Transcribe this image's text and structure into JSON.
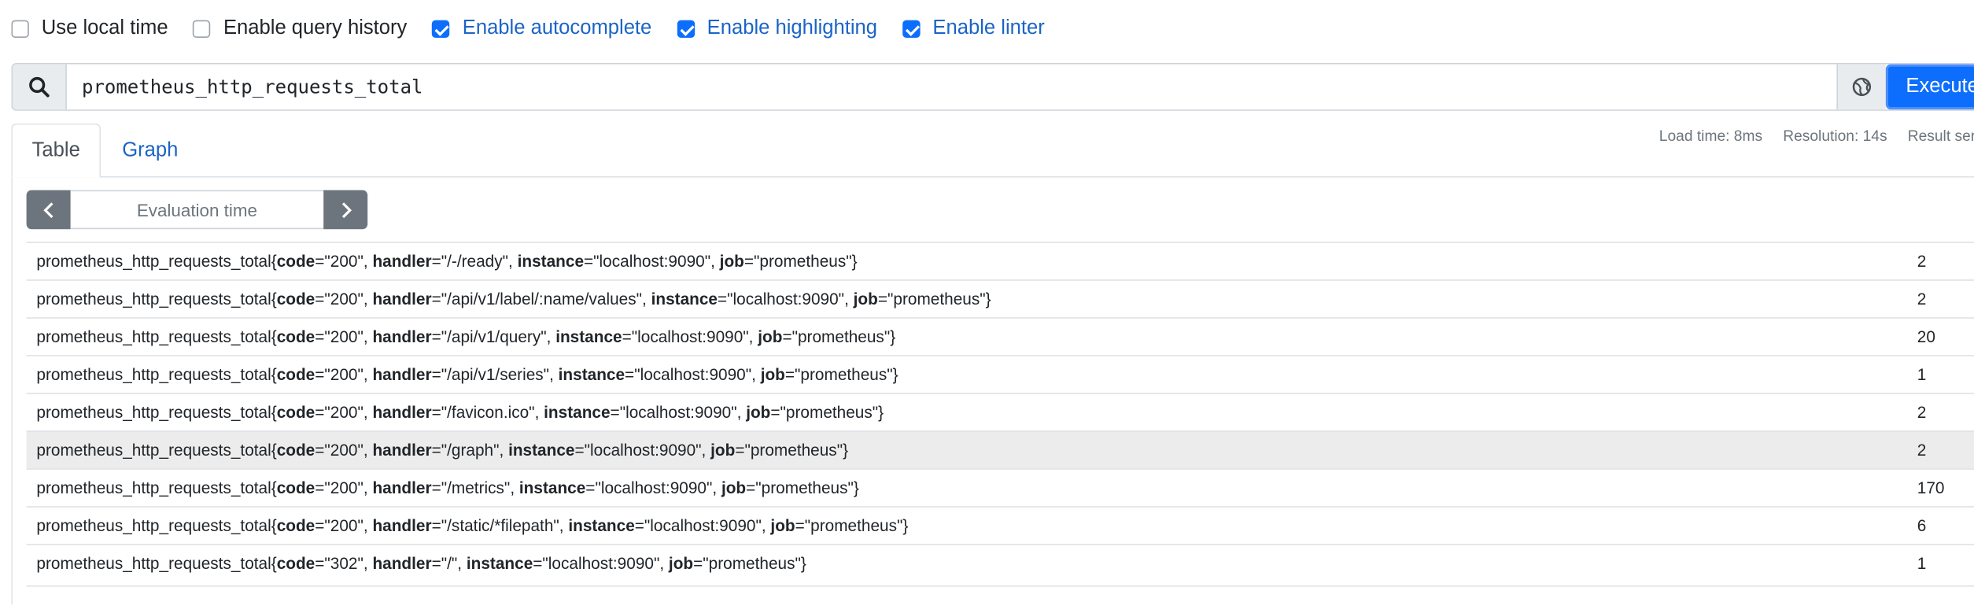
{
  "options": [
    {
      "label": "Use local time",
      "checked": false
    },
    {
      "label": "Enable query history",
      "checked": false
    },
    {
      "label": "Enable autocomplete",
      "checked": true
    },
    {
      "label": "Enable highlighting",
      "checked": true
    },
    {
      "label": "Enable linter",
      "checked": true
    }
  ],
  "query": {
    "value": "prometheus_http_requests_total",
    "execute_label": "Execute"
  },
  "stats": {
    "load_time": "Load time: 8ms",
    "resolution": "Resolution: 14s",
    "result_series": "Result series"
  },
  "tabs": {
    "table": "Table",
    "graph": "Graph"
  },
  "eval": {
    "placeholder": "Evaluation time"
  },
  "colors": {
    "accent": "#0d6efd",
    "link": "#1a64c8",
    "nav_button": "#6c757d",
    "highlight_row": "#ececec"
  },
  "results": {
    "metric": "prometheus_http_requests_total",
    "rows": [
      {
        "labels": [
          {
            "k": "code",
            "v": "\"200\""
          },
          {
            "k": "handler",
            "v": "\"/-/ready\""
          },
          {
            "k": "instance",
            "v": "\"localhost:9090\""
          },
          {
            "k": "job",
            "v": "\"prometheus\""
          }
        ],
        "value": "2"
      },
      {
        "labels": [
          {
            "k": "code",
            "v": "\"200\""
          },
          {
            "k": "handler",
            "v": "\"/api/v1/label/:name/values\""
          },
          {
            "k": "instance",
            "v": "\"localhost:9090\""
          },
          {
            "k": "job",
            "v": "\"prometheus\""
          }
        ],
        "value": "2"
      },
      {
        "labels": [
          {
            "k": "code",
            "v": "\"200\""
          },
          {
            "k": "handler",
            "v": "\"/api/v1/query\""
          },
          {
            "k": "instance",
            "v": "\"localhost:9090\""
          },
          {
            "k": "job",
            "v": "\"prometheus\""
          }
        ],
        "value": "20"
      },
      {
        "labels": [
          {
            "k": "code",
            "v": "\"200\""
          },
          {
            "k": "handler",
            "v": "\"/api/v1/series\""
          },
          {
            "k": "instance",
            "v": "\"localhost:9090\""
          },
          {
            "k": "job",
            "v": "\"prometheus\""
          }
        ],
        "value": "1"
      },
      {
        "labels": [
          {
            "k": "code",
            "v": "\"200\""
          },
          {
            "k": "handler",
            "v": "\"/favicon.ico\""
          },
          {
            "k": "instance",
            "v": "\"localhost:9090\""
          },
          {
            "k": "job",
            "v": "\"prometheus\""
          }
        ],
        "value": "2"
      },
      {
        "labels": [
          {
            "k": "code",
            "v": "\"200\""
          },
          {
            "k": "handler",
            "v": "\"/graph\""
          },
          {
            "k": "instance",
            "v": "\"localhost:9090\""
          },
          {
            "k": "job",
            "v": "\"prometheus\""
          }
        ],
        "value": "2",
        "highlighted": true
      },
      {
        "labels": [
          {
            "k": "code",
            "v": "\"200\""
          },
          {
            "k": "handler",
            "v": "\"/metrics\""
          },
          {
            "k": "instance",
            "v": "\"localhost:9090\""
          },
          {
            "k": "job",
            "v": "\"prometheus\""
          }
        ],
        "value": "170"
      },
      {
        "labels": [
          {
            "k": "code",
            "v": "\"200\""
          },
          {
            "k": "handler",
            "v": "\"/static/*filepath\""
          },
          {
            "k": "instance",
            "v": "\"localhost:9090\""
          },
          {
            "k": "job",
            "v": "\"prometheus\""
          }
        ],
        "value": "6"
      },
      {
        "labels": [
          {
            "k": "code",
            "v": "\"302\""
          },
          {
            "k": "handler",
            "v": "\"/\""
          },
          {
            "k": "instance",
            "v": "\"localhost:9090\""
          },
          {
            "k": "job",
            "v": "\"prometheus\""
          }
        ],
        "value": "1"
      }
    ]
  }
}
